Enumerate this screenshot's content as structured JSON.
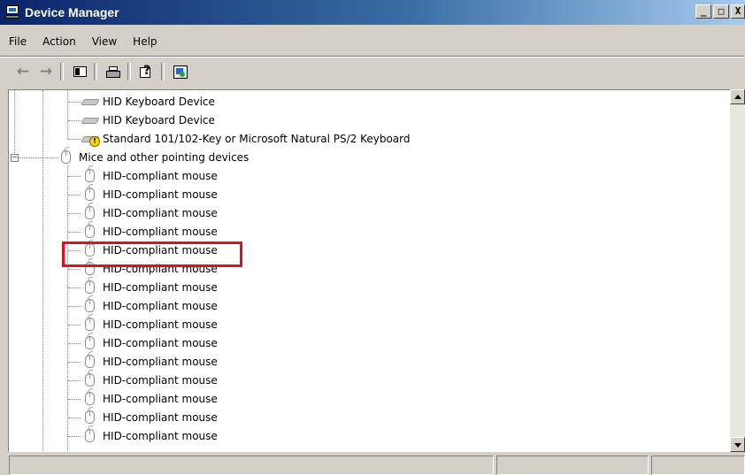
{
  "window": {
    "title": "Device Manager",
    "controls": {
      "minimize": "_",
      "maximize": "□",
      "close": "X"
    }
  },
  "menu": {
    "items": [
      {
        "label": "File"
      },
      {
        "label": "Action"
      },
      {
        "label": "View"
      },
      {
        "label": "Help"
      }
    ]
  },
  "toolbar": {
    "buttons": [
      "back-icon",
      "forward-icon",
      "properties-icon",
      "print-icon",
      "help-icon",
      "scan-hardware-icon"
    ]
  },
  "tree": {
    "keyboard_items": [
      {
        "label": "HID Keyboard Device",
        "icon": "keyboard-icon"
      },
      {
        "label": "HID Keyboard Device",
        "icon": "keyboard-icon"
      },
      {
        "label": "Standard 101/102-Key or Microsoft Natural PS/2 Keyboard",
        "icon": "keyboard-warning-icon"
      }
    ],
    "category": {
      "label": "Mice and other pointing devices",
      "icon": "mouse-icon",
      "expanded": true
    },
    "mouse_items": [
      {
        "label": "HID-compliant mouse"
      },
      {
        "label": "HID-compliant mouse"
      },
      {
        "label": "HID-compliant mouse"
      },
      {
        "label": "HID-compliant mouse"
      },
      {
        "label": "HID-compliant mouse",
        "highlighted": true
      },
      {
        "label": "HID-compliant mouse"
      },
      {
        "label": "HID-compliant mouse"
      },
      {
        "label": "HID-compliant mouse"
      },
      {
        "label": "HID-compliant mouse"
      },
      {
        "label": "HID-compliant mouse"
      },
      {
        "label": "HID-compliant mouse"
      },
      {
        "label": "HID-compliant mouse"
      },
      {
        "label": "HID-compliant mouse"
      },
      {
        "label": "HID-compliant mouse"
      },
      {
        "label": "HID-compliant mouse"
      }
    ]
  },
  "colors": {
    "highlight_border": "#e0101a",
    "title_gradient_start": "#0a246a",
    "title_gradient_end": "#a6caf0"
  }
}
